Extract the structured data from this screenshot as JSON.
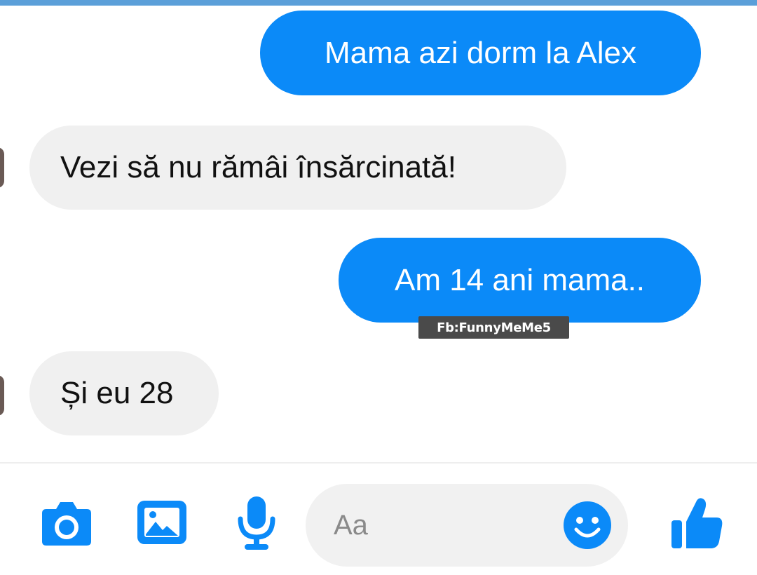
{
  "messages": [
    {
      "direction": "outgoing",
      "text": "Mama azi dorm la Alex"
    },
    {
      "direction": "incoming",
      "text": "Vezi să nu rămâi însărcinată!"
    },
    {
      "direction": "outgoing",
      "text": "Am 14 ani mama.."
    },
    {
      "direction": "incoming",
      "text": "Și eu 28"
    }
  ],
  "watermark": "Fb:FunnyMeMe5",
  "composer": {
    "placeholder": "Aa",
    "icons": [
      "camera-icon",
      "image-icon",
      "microphone-icon",
      "emoji-icon",
      "thumbs-up-icon"
    ]
  },
  "colors": {
    "accent": "#0b8af8",
    "incoming_bubble": "#f0f0f0",
    "top_strip": "#5b9fd9"
  }
}
